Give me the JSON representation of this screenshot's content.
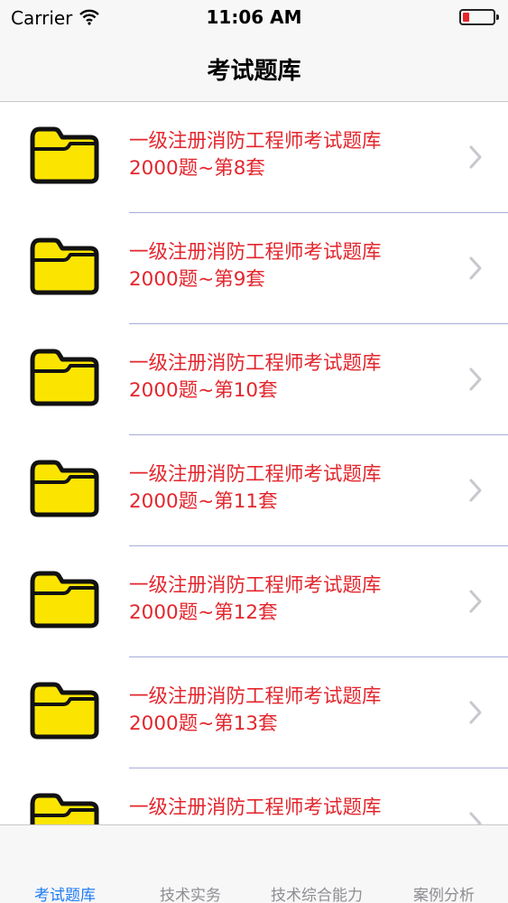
{
  "status_bar": {
    "carrier": "Carrier",
    "time": "11:06 AM",
    "battery_color": "#e5262a"
  },
  "nav": {
    "title": "考试题库"
  },
  "list": {
    "title_color": "#e3262d",
    "separator_color": "#a8acd8",
    "items": [
      {
        "icon": "folder-icon",
        "line1": "一级注册消防工程师考试题库",
        "line2": "2000题~第8套"
      },
      {
        "icon": "folder-icon",
        "line1": "一级注册消防工程师考试题库",
        "line2": "2000题~第9套"
      },
      {
        "icon": "folder-icon",
        "line1": "一级注册消防工程师考试题库",
        "line2": "2000题~第10套"
      },
      {
        "icon": "folder-icon",
        "line1": "一级注册消防工程师考试题库",
        "line2": "2000题~第11套"
      },
      {
        "icon": "folder-icon",
        "line1": "一级注册消防工程师考试题库",
        "line2": "2000题~第12套"
      },
      {
        "icon": "folder-icon",
        "line1": "一级注册消防工程师考试题库",
        "line2": "2000题~第13套"
      },
      {
        "icon": "folder-icon",
        "line1": "一级注册消防工程师考试题库",
        "line2": ""
      }
    ]
  },
  "tab_bar": {
    "active_color": "#1f7cf4",
    "inactive_color": "#8e8e93",
    "tabs": [
      {
        "label": "考试题库",
        "active": true
      },
      {
        "label": "技术实务",
        "active": false
      },
      {
        "label": "技术综合能力",
        "active": false
      },
      {
        "label": "案例分析",
        "active": false
      }
    ]
  }
}
